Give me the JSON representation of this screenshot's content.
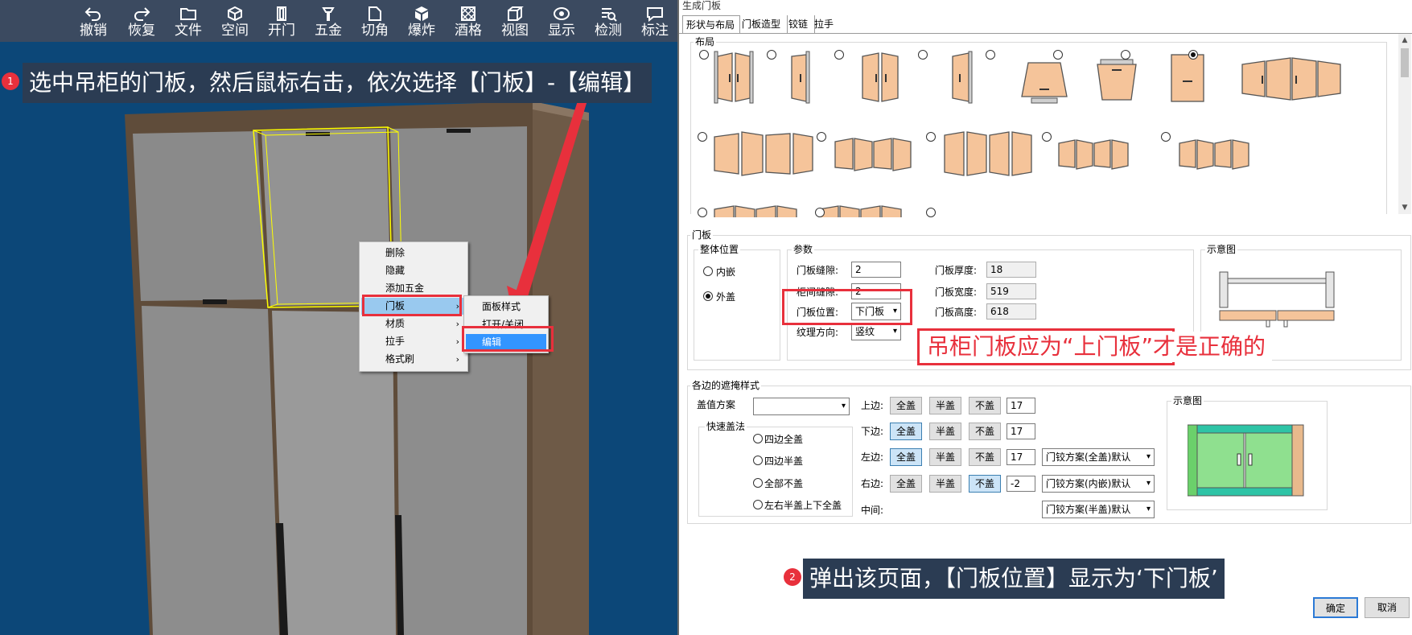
{
  "toolbar": {
    "items": [
      {
        "label": "撤销",
        "icon": "undo-icon"
      },
      {
        "label": "恢复",
        "icon": "redo-icon"
      },
      {
        "label": "文件",
        "icon": "folder-icon"
      },
      {
        "label": "空间",
        "icon": "cube-icon"
      },
      {
        "label": "开门",
        "icon": "door-icon"
      },
      {
        "label": "五金",
        "icon": "hardware-icon"
      },
      {
        "label": "切角",
        "icon": "corner-cut-icon"
      },
      {
        "label": "爆炸",
        "icon": "explode-icon"
      },
      {
        "label": "酒格",
        "icon": "wine-grid-icon"
      },
      {
        "label": "视图",
        "icon": "view-icon"
      },
      {
        "label": "显示",
        "icon": "eye-icon"
      },
      {
        "label": "检测",
        "icon": "check-icon"
      },
      {
        "label": "标注",
        "icon": "annotate-icon"
      }
    ]
  },
  "step1": {
    "badge": "1",
    "text": "选中吊柜的门板，然后鼠标右击，依次选择【门板】-【编辑】"
  },
  "step2": {
    "badge": "2",
    "text": "弹出该页面，【门板位置】显示为‘下门板’"
  },
  "hint": "吊柜门板应为“上门板”才是正确的",
  "context_menu": {
    "items": [
      "删除",
      "隐藏",
      "添加五金",
      "门板",
      "材质",
      "拉手",
      "格式刷"
    ],
    "submenu": [
      "面板样式",
      "打开/关闭",
      "编辑"
    ]
  },
  "dialog": {
    "title": "生成门板",
    "tabs": [
      "形状与布局",
      "门板造型",
      "铰链",
      "拉手"
    ],
    "layout_group": "布局",
    "door_group": "门板",
    "position_group": "整体位置",
    "position_options": [
      "内嵌",
      "外盖"
    ],
    "params_group": "参数",
    "params": {
      "gap_label": "门板缝隙:",
      "gap_value": "2",
      "cab_gap_label": "柜间缝隙:",
      "cab_gap_value": "2",
      "pos_label": "门板位置:",
      "pos_value": "下门板",
      "grain_label": "纹理方向:",
      "grain_value": "竖纹",
      "thickness_label": "门板厚度:",
      "thickness_value": "18",
      "width_label": "门板宽度:",
      "width_value": "519",
      "height_label": "门板高度:",
      "height_value": "618"
    },
    "preview_label": "示意图",
    "cover_group": "各边的遮掩样式",
    "cover_scheme_label": "盖值方案",
    "quick_cover_label": "快速盖法",
    "quick_cover_options": [
      "四边全盖",
      "四边半盖",
      "全部不盖",
      "左右半盖上下全盖"
    ],
    "edges": [
      {
        "label": "上边:",
        "value": "17",
        "scheme": ""
      },
      {
        "label": "下边:",
        "value": "17",
        "scheme": ""
      },
      {
        "label": "左边:",
        "value": "17",
        "scheme": "门铰方案(全盖)默认"
      },
      {
        "label": "右边:",
        "value": "-2",
        "scheme": "门铰方案(内嵌)默认"
      }
    ],
    "middle_label": "中间:",
    "middle_scheme": "门铰方案(半盖)默认",
    "cover_buttons": [
      "全盖",
      "半盖",
      "不盖"
    ],
    "preview2_label": "示意图",
    "ok_label": "确定",
    "cancel_label": "取消"
  },
  "colors": {
    "accent_red": "#e8303c",
    "callout_bg": "#2b3c53",
    "door_fill": "#f5c49a",
    "viewport_bg": "#0c4778"
  }
}
